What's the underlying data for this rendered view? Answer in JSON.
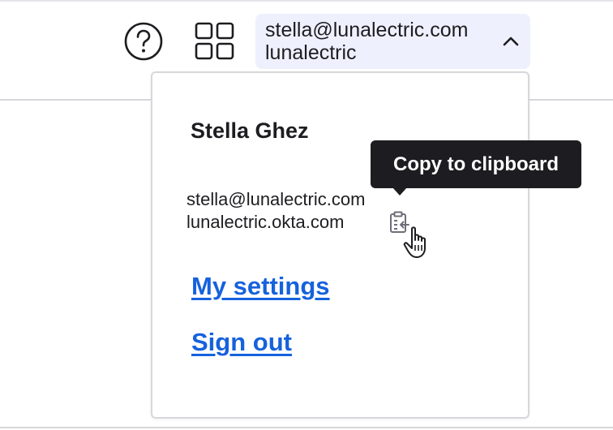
{
  "header": {
    "help_icon": "question-circle-icon",
    "apps_icon": "app-grid-icon",
    "account": {
      "email": "stella@lunalectric.com",
      "org": "lunalectric",
      "chevron_icon": "chevron-up-icon",
      "background": "#eef1fd"
    }
  },
  "dropdown": {
    "user_name": "Stella Ghez",
    "email": "stella@lunalectric.com",
    "domain": "lunalectric.okta.com",
    "copy_icon": "clipboard-copy-icon",
    "links": {
      "settings": "My settings",
      "sign_out": "Sign out"
    },
    "link_color": "#1662dd"
  },
  "tooltip": {
    "text": "Copy to clipboard"
  },
  "cursor_icon": "hand-pointer-icon"
}
